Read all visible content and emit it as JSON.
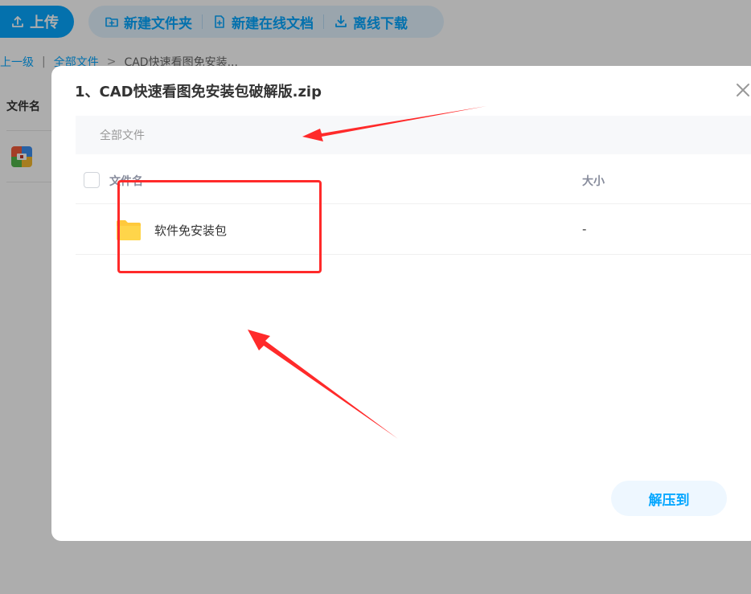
{
  "toolbar": {
    "upload_label": "上传",
    "new_folder_label": "新建文件夹",
    "new_doc_label": "新建在线文档",
    "offline_download_label": "离线下载"
  },
  "breadcrumb": {
    "back_label": "上一级",
    "root_label": "全部文件",
    "current_label": "CAD快速看图免安装..."
  },
  "background_list": {
    "header_name": "文件名"
  },
  "modal": {
    "title": "1、CAD快速看图免安装包破解版.zip",
    "path_label": "全部文件",
    "columns": {
      "name": "文件名",
      "size": "大小"
    },
    "rows": [
      {
        "name": "软件免安装包",
        "size": "-"
      }
    ],
    "extract_label": "解压到"
  },
  "colors": {
    "accent": "#06a7ff",
    "annotation": "#ff2a2a",
    "folder": "#ffd54a"
  }
}
